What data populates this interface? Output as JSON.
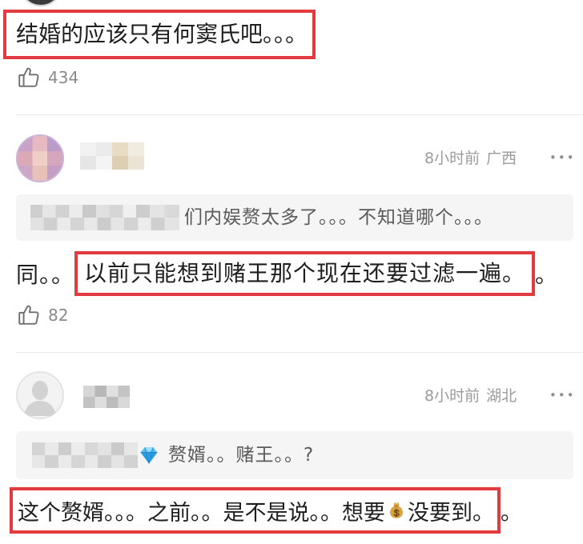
{
  "first_comment": {
    "text": "结婚的应该只有何窦氏吧。。。",
    "like_count": "434"
  },
  "comments": [
    {
      "time": "8小时前",
      "location": "广西",
      "more_label": "•••",
      "quote": {
        "text": "们内娱赘太多了。。。不知道哪个。。。"
      },
      "body": {
        "before_highlight": "同。。",
        "highlight": "以前只能想到赌王那个现在还要过滤一遍。",
        "after_highlight": "。"
      },
      "like_count": "82"
    },
    {
      "time": "8小时前",
      "location": "湖北",
      "more_label": "•••",
      "quote": {
        "icon": "gem-icon",
        "text": "赘婿。。赌王。。?"
      },
      "body": {
        "highlight_part1": "这个赘婿。。。之前。。是不是说。。想要",
        "highlight_icon": "money-bag-icon",
        "highlight_part2": "没要到。",
        "after_highlight": "。"
      }
    }
  ],
  "icons": {
    "like": "thumbs-up-icon",
    "more": "more-dots-icon",
    "default_avatar": "default-avatar-icon"
  },
  "colors": {
    "highlight_border": "#e23a3f",
    "body_text": "#1e1e1e",
    "meta_text": "#9b9b9b",
    "quote_background": "#f5f5f5",
    "quote_text": "#5a5a5a",
    "divider": "#e9e9e9"
  }
}
